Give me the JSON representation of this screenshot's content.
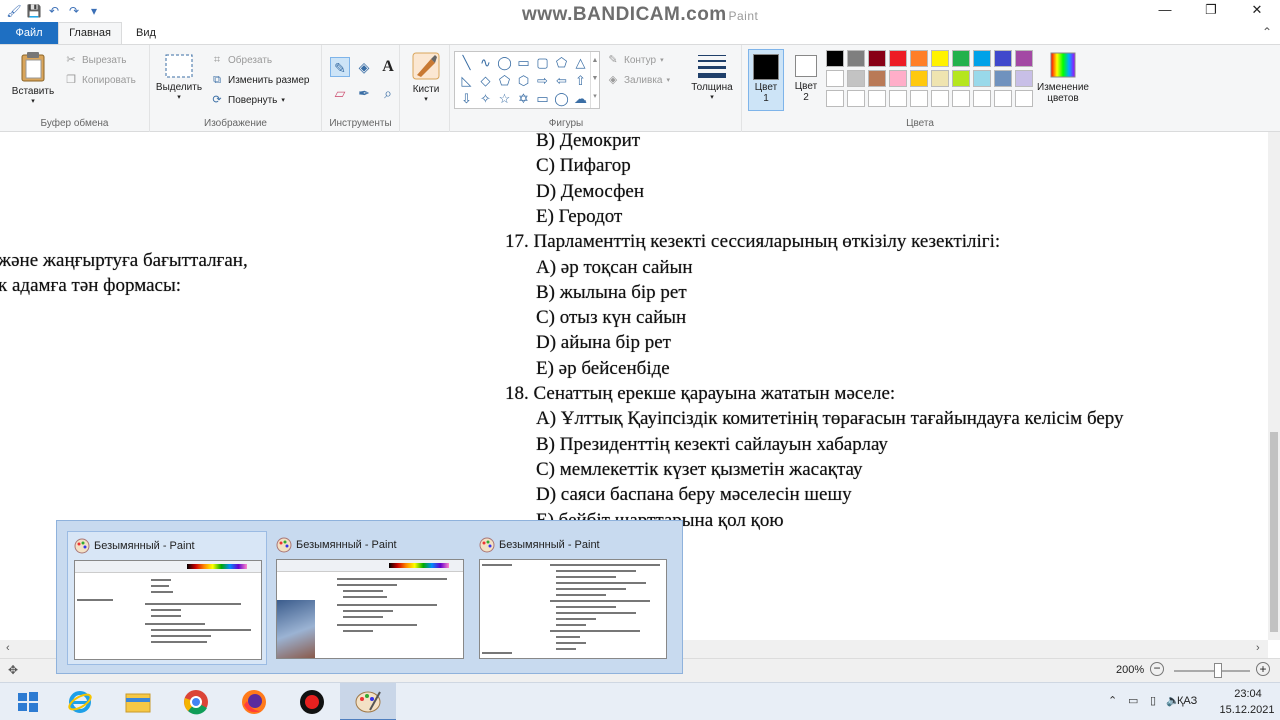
{
  "watermark": {
    "text": "www.BANDICAM.com",
    "paint_suffix": "Paint"
  },
  "window_controls": {
    "minimize": "—",
    "maximize": "❐",
    "close": "✕"
  },
  "tabs": {
    "file": "Файл",
    "home": "Главная",
    "view": "Вид"
  },
  "clipboard": {
    "paste": "Вставить",
    "cut": "Вырезать",
    "copy": "Копировать",
    "label": "Буфер обмена"
  },
  "image": {
    "select": "Выделить",
    "crop": "Обрезать",
    "resize": "Изменить размер",
    "rotate": "Повернуть",
    "label": "Изображение"
  },
  "tools": {
    "label": "Инструменты"
  },
  "brushes": {
    "label": "Кисти"
  },
  "shapes": {
    "outline": "Контур",
    "fill": "Заливка",
    "label": "Фигуры"
  },
  "thickness": {
    "label": "Толщина"
  },
  "colors": {
    "color1_label": "Цвет",
    "color1_num": "1",
    "color2_label": "Цвет",
    "color2_num": "2",
    "edit_label_line1": "Изменение",
    "edit_label_line2": "цветов",
    "label": "Цвета",
    "color1": "#000000",
    "color2": "#ffffff",
    "palette": [
      "#000000",
      "#7f7f7f",
      "#880015",
      "#ed1c24",
      "#ff7f27",
      "#fff200",
      "#22b14c",
      "#00a2e8",
      "#3f48cc",
      "#a349a4",
      "#ffffff",
      "#c3c3c3",
      "#b97a57",
      "#ffaec9",
      "#ffc90e",
      "#efe4b0",
      "#b5e61d",
      "#99d9ea",
      "#7092be",
      "#c8bfe7",
      "#ffffff",
      "#ffffff",
      "#ffffff",
      "#ffffff",
      "#ffffff",
      "#ffffff",
      "#ffffff",
      "#ffffff",
      "#ffffff",
      "#ffffff"
    ]
  },
  "document": {
    "left_line1": "жəне жаңғыртуға бағытталған,",
    "left_line2": "к адамға тəн формасы:",
    "lines": [
      "B) Демокрит",
      "C) Пифагор",
      "D) Демосфен",
      "E) Геродот",
      "17. Парламенттің кезекті сессияларының өткізілу кезектілігі:",
      "A) әр тоқсан сайын",
      "B) жылына бір рет",
      "C) отыз күн сайын",
      "D) айына бір рет",
      "E) әр бейсенбіде",
      "18. Сенаттың ерекше қарауына жататын мəселе:",
      "A) Ұлттық Қауіпсіздік комитетінің төрағасын тағайындауға келісім беру",
      "B) Президенттің кезекті сайлауын хабарлау",
      "C) мемлекеттік күзет қызметін жасақтау",
      "D) саяси баспана беру мəселесін шешу",
      "E) бейбіт шарттарына қол қою"
    ]
  },
  "thumbnails": [
    {
      "title": "Безымянный - Paint"
    },
    {
      "title": "Безымянный - Paint"
    },
    {
      "title": "Безымянный - Paint"
    }
  ],
  "status": {
    "zoom": "200%",
    "minus": "−",
    "plus": "+"
  },
  "taskbar": {
    "lang": "ҚАЗ",
    "time": "23:04",
    "date": "15.12.2021"
  }
}
